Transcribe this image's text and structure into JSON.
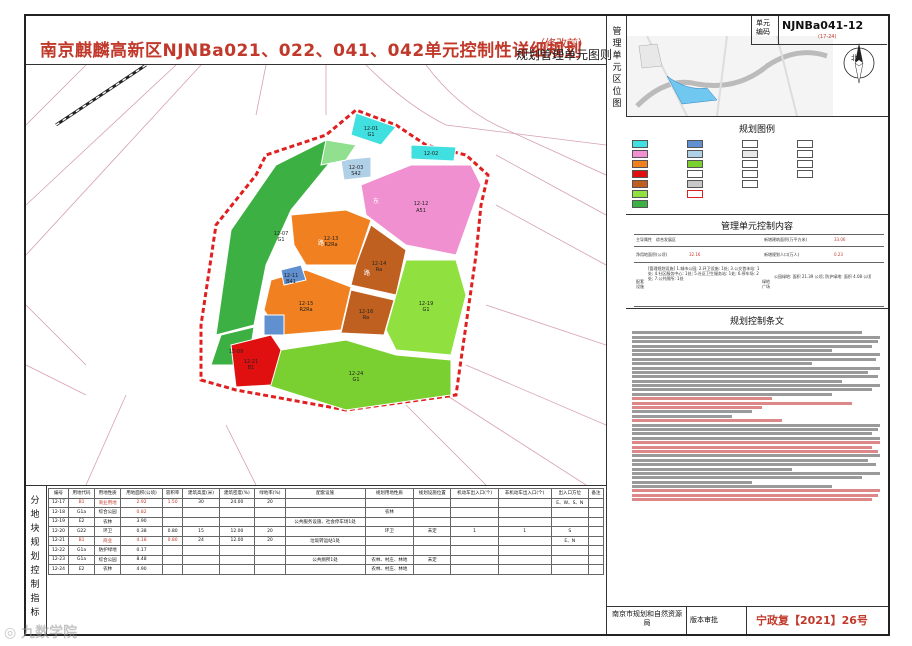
{
  "title": "南京麒麟高新区NJNBa021、022、041、042单元控制性详细规划",
  "subtitle_tag": "（修改前）",
  "subtitle": "规划管理单元图则",
  "side_labels": {
    "unit_location": "管理单元区位图",
    "sub_plot_control": "分地块规划控制指标"
  },
  "unit_code": {
    "label": "单元编码",
    "value": "NJNBa041-12",
    "sub": "(17-24)"
  },
  "legend_title": "规划图例",
  "control_title": "管理单元控制内容",
  "control": {
    "function_label": "主导属性",
    "function_value": "综合发展区",
    "area_label": "新增建筑面积(万平方米)",
    "area_value": "33.06",
    "land_label": "净用地面积(公顷)",
    "land_value": "32.16",
    "pop_label": "新增规划人口(万人)",
    "pop_value": "0.23",
    "facilities_label": "配套设施",
    "facilities_text": "[管理规划设施] 1.城市公园; 2.环卫设施: 1处; 3.公交首末站: 1处; 4.社区服务中心: 1处; 5.社区卫生服务站: 1处; 6.停车场: 2处; 7.公共厕所: 1处",
    "green_label": "绿地广场",
    "green_text": "公园绿地: 面积 21.39 公顷; 防护绿地: 面积 4.08 公顷"
  },
  "rules_title": "规划控制条文",
  "map": {
    "compass": "北",
    "parcels": [
      {
        "id": "12-01",
        "code": "G1"
      },
      {
        "id": "12-02",
        "code": "G1"
      },
      {
        "id": "12-03",
        "code": "S42"
      },
      {
        "id": "12-04",
        "code": "S2"
      },
      {
        "id": "12-05",
        "code": "G1"
      },
      {
        "id": "12-06",
        "code": "G1"
      },
      {
        "id": "12-07",
        "code": "G1"
      },
      {
        "id": "12-08",
        "code": "G1"
      },
      {
        "id": "12-09",
        "code": "G1"
      },
      {
        "id": "12-10",
        "code": "G1"
      },
      {
        "id": "12-11",
        "code": "B41"
      },
      {
        "id": "12-12",
        "code": "A51"
      },
      {
        "id": "12-13",
        "code": "R2Ra"
      },
      {
        "id": "12-14",
        "code": "Ra"
      },
      {
        "id": "12-15",
        "code": "R2Ra"
      },
      {
        "id": "12-16",
        "code": "Ra"
      },
      {
        "id": "12-17",
        "code": "B1"
      },
      {
        "id": "12-18",
        "code": "B"
      },
      {
        "id": "12-19",
        "code": "G1"
      },
      {
        "id": "12-20",
        "code": "S4"
      },
      {
        "id": "12-21",
        "code": "B1"
      },
      {
        "id": "12-22",
        "code": "G1a"
      },
      {
        "id": "12-23",
        "code": "G1a"
      },
      {
        "id": "12-24",
        "code": "G1"
      }
    ]
  },
  "table": {
    "headers": [
      "编号",
      "用地代码",
      "用地性质",
      "用地面积(公顷)",
      "容积率",
      "建筑高度(米)",
      "建筑密度(%)",
      "绿地率(%)",
      "配套设施",
      "规划用地性质",
      "规划设施位置",
      "机动车出入口(个)",
      "非机动车出入口(个)",
      "出入口方位",
      "备注"
    ],
    "rows": [
      [
        "12-17",
        "B1",
        "商业用地",
        "2.92",
        "1.50",
        "30",
        "24.00",
        "20",
        "",
        "",
        "",
        "",
        "",
        "E、W、S、N",
        ""
      ],
      [
        "12-18",
        "G1a",
        "综合公园",
        "0.82",
        "",
        "",
        "",
        "",
        "",
        "农林",
        "",
        "",
        "",
        "",
        ""
      ],
      [
        "12-19",
        "E2",
        "农林",
        "3.90",
        "",
        "",
        "",
        "",
        "公共服务设施、社会停车场1处",
        "",
        "",
        "",
        "",
        "",
        ""
      ],
      [
        "12-20",
        "G22",
        "环卫",
        "0.38",
        "0.80",
        "15",
        "12.00",
        "20",
        "",
        "环卫",
        "未定",
        "1",
        "1",
        "S",
        ""
      ],
      [
        "12-21",
        "B1",
        "商业",
        "4.18",
        "0.80",
        "24",
        "12.00",
        "20",
        "垃圾转运站1处",
        "",
        "",
        "",
        "",
        "E、N",
        ""
      ],
      [
        "12-22",
        "G1a",
        "防护绿地",
        "0.17",
        "",
        "",
        "",
        "",
        "",
        "",
        "",
        "",
        "",
        "",
        ""
      ],
      [
        "12-23",
        "G1a",
        "综合公园",
        "8.48",
        "",
        "",
        "",
        "",
        "公共厕所1处",
        "农林、村庄、林地",
        "未定",
        "",
        "",
        "",
        ""
      ],
      [
        "12-24",
        "E2",
        "农林",
        "4.90",
        "",
        "",
        "",
        "",
        "",
        "农林、村庄、林地",
        "",
        "",
        "",
        "",
        ""
      ]
    ]
  },
  "footer": {
    "agency": "南京市规划和自然资源局",
    "approval_label": "版本审批",
    "approval_no": "宁政复【2021】26号"
  },
  "watermark": "九数学院"
}
